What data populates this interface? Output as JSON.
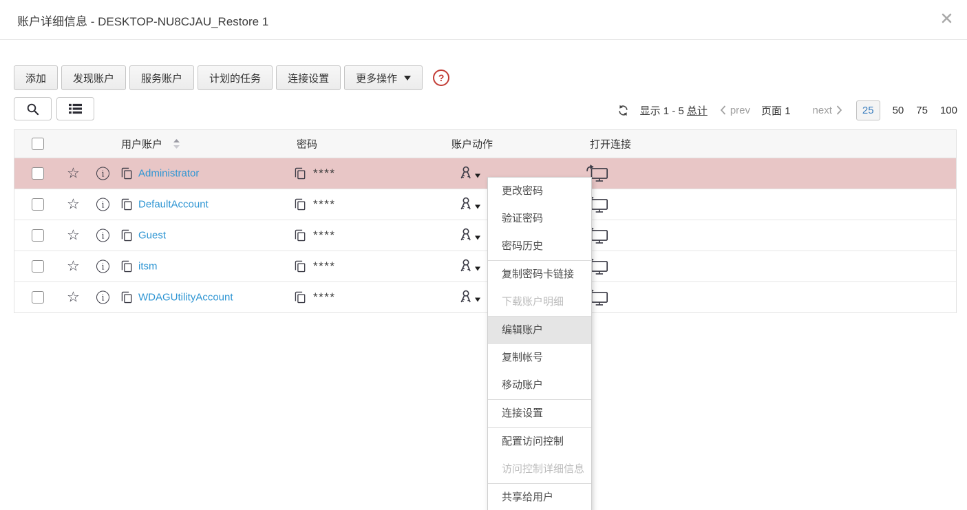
{
  "window": {
    "title": "账户详细信息 - DESKTOP-NU8CJAU_Restore 1"
  },
  "toolbar": {
    "add": "添加",
    "discover_accounts": "发现账户",
    "service_accounts": "服务账户",
    "scheduled_tasks": "计划的任务",
    "connection_settings": "连接设置",
    "more_actions": "更多操作",
    "help": "?"
  },
  "pagination": {
    "showing": "显示 1 - 5",
    "total_link": "总计",
    "prev": "prev",
    "page": "页面 1",
    "next": "next",
    "page_sizes": [
      "25",
      "50",
      "75",
      "100"
    ],
    "active_page_size": "25"
  },
  "table": {
    "columns": {
      "user_account": "用户账户",
      "password": "密码",
      "account_actions": "账户动作",
      "open_connection": "打开连接"
    },
    "rows": [
      {
        "name": "Administrator",
        "password": "****",
        "highlighted": true
      },
      {
        "name": "DefaultAccount",
        "password": "****",
        "highlighted": false
      },
      {
        "name": "Guest",
        "password": "****",
        "highlighted": false
      },
      {
        "name": "itsm",
        "password": "****",
        "highlighted": false
      },
      {
        "name": "WDAGUtilityAccount",
        "password": "****",
        "highlighted": false
      }
    ]
  },
  "context_menu": {
    "items": [
      {
        "label": "更改密码",
        "state": "normal"
      },
      {
        "label": "验证密码",
        "state": "normal"
      },
      {
        "label": "密码历史",
        "state": "normal"
      },
      {
        "label": "复制密码卡链接",
        "state": "normal"
      },
      {
        "label": "下载账户明细",
        "state": "disabled"
      },
      {
        "label": "编辑账户",
        "state": "hovered"
      },
      {
        "label": "复制帐号",
        "state": "normal"
      },
      {
        "label": "移动账户",
        "state": "normal"
      },
      {
        "label": "连接设置",
        "state": "normal"
      },
      {
        "label": "配置访问控制",
        "state": "normal"
      },
      {
        "label": "访问控制详细信息",
        "state": "disabled"
      },
      {
        "label": "共享给用户",
        "state": "normal"
      }
    ]
  },
  "colors": {
    "highlighted_row": "#e8c6c6",
    "link_blue": "#2e95d3",
    "help_red": "#c23b34",
    "menu_hover": "#e5e5e5",
    "active_page_size_blue": "#3a7ebf"
  }
}
